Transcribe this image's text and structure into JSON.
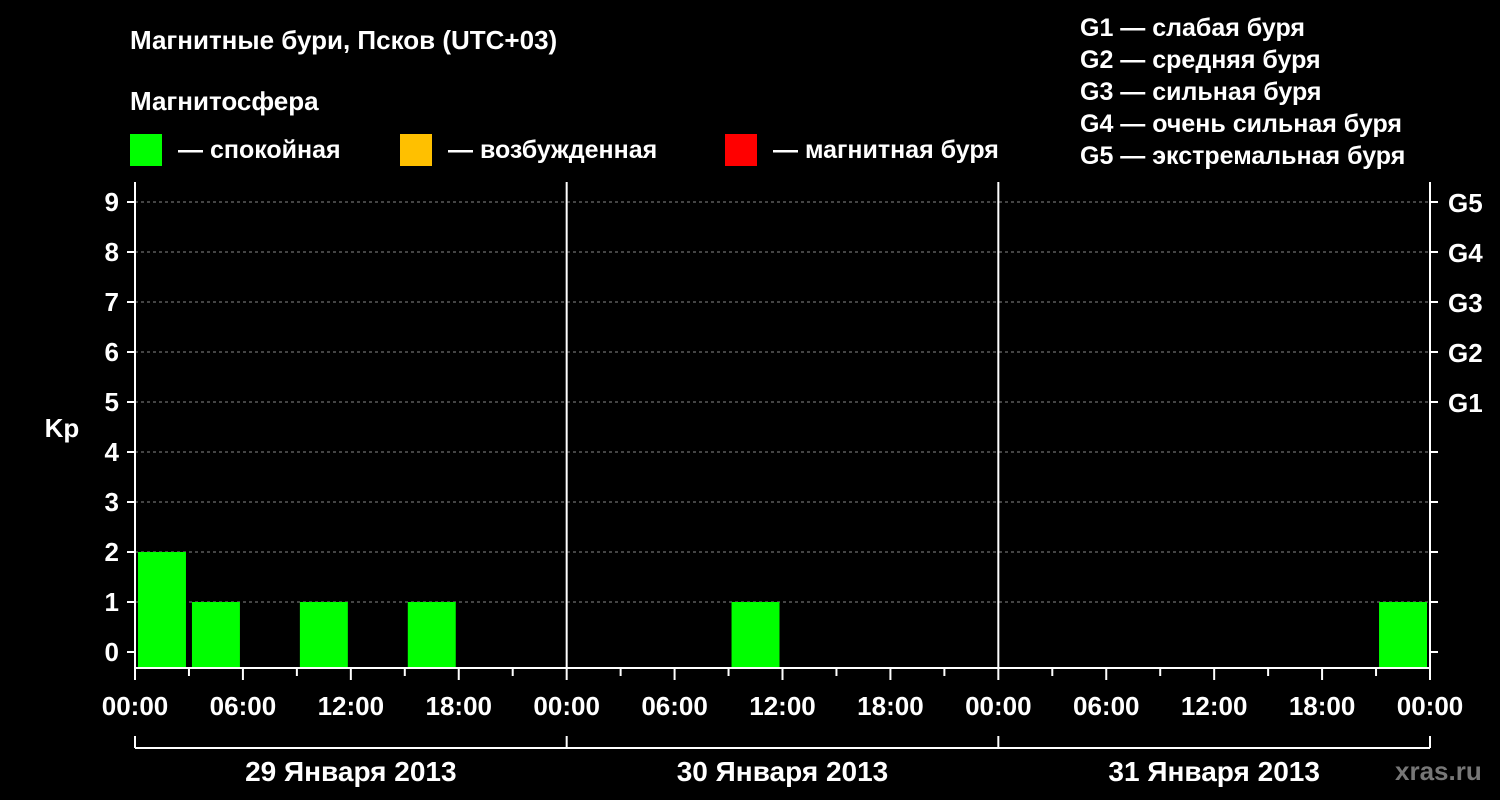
{
  "title": "Магнитные бури, Псков (UTC+03)",
  "magnetosphere_label": "Магнитосфера",
  "legend": [
    {
      "label": "— спокойная",
      "color": "#00ff00"
    },
    {
      "label": "— возбужденная",
      "color": "#ffc000"
    },
    {
      "label": "— магнитная буря",
      "color": "#ff0000"
    }
  ],
  "storm_levels": [
    {
      "code": "G1",
      "label": "G1 — слабая буря"
    },
    {
      "code": "G2",
      "label": "G2 — средняя буря"
    },
    {
      "code": "G3",
      "label": "G3 — сильная буря"
    },
    {
      "code": "G4",
      "label": "G4 — очень сильная буря"
    },
    {
      "code": "G5",
      "label": "G5 — экстремальная буря"
    }
  ],
  "watermark": "xras.ru",
  "chart_data": {
    "type": "bar",
    "ylabel": "Kp",
    "ylim": [
      0,
      9
    ],
    "y_ticks": [
      "0",
      "1",
      "2",
      "3",
      "4",
      "5",
      "6",
      "7",
      "8",
      "9"
    ],
    "right_ticks": [
      {
        "value": 5,
        "label": "G1"
      },
      {
        "value": 6,
        "label": "G2"
      },
      {
        "value": 7,
        "label": "G3"
      },
      {
        "value": 8,
        "label": "G4"
      },
      {
        "value": 9,
        "label": "G5"
      }
    ],
    "x_tick_labels": [
      "00:00",
      "06:00",
      "12:00",
      "18:00",
      "00:00",
      "06:00",
      "12:00",
      "18:00",
      "00:00",
      "06:00",
      "12:00",
      "18:00",
      "00:00"
    ],
    "days": [
      "29 Января 2013",
      "30 Января 2013",
      "31 Января 2013"
    ],
    "interval_hours": 3,
    "grid": "dashed horizontal",
    "series": [
      {
        "values": [
          2,
          1,
          0,
          1,
          0,
          1,
          0,
          0,
          0,
          0,
          0,
          1,
          0,
          0,
          0,
          0,
          0,
          0,
          0,
          0,
          0,
          0,
          0,
          1
        ],
        "colors": [
          "#00ff00",
          "#00ff00",
          "#00ff00",
          "#00ff00",
          "#00ff00",
          "#00ff00",
          "#00ff00",
          "#00ff00",
          "#00ff00",
          "#00ff00",
          "#00ff00",
          "#00ff00",
          "#00ff00",
          "#00ff00",
          "#00ff00",
          "#00ff00",
          "#00ff00",
          "#00ff00",
          "#00ff00",
          "#00ff00",
          "#00ff00",
          "#00ff00",
          "#00ff00",
          "#00ff00"
        ]
      }
    ]
  }
}
